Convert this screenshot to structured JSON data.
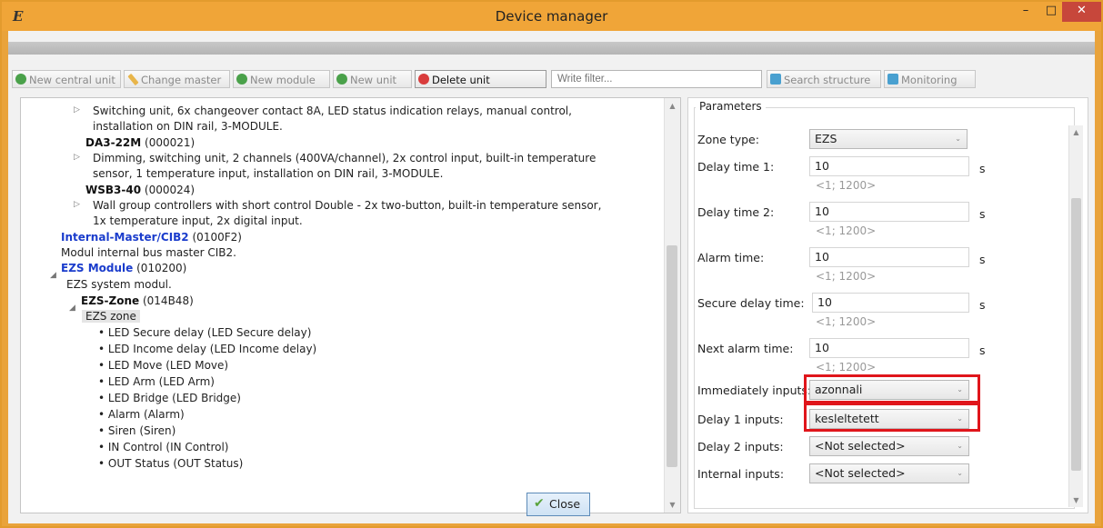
{
  "window": {
    "title": "Device manager",
    "app_icon": "E",
    "minimize": "–",
    "maximize": "□",
    "close": "✕"
  },
  "toolbar": {
    "new_central_unit": "New central unit",
    "change_master": "Change master",
    "new_module": "New module",
    "new_unit": "New unit",
    "delete_unit": "Delete unit",
    "filter_placeholder": "Write filter...",
    "search_structure": "Search structure",
    "monitoring": "Monitoring"
  },
  "tree": {
    "switching_desc_1": "Switching unit, 6x changeover contact 8A, LED status indication relays, manual control,",
    "switching_desc_2": "installation on DIN rail, 3-MODULE.",
    "da3_name": "DA3-22M",
    "da3_id": "(000021)",
    "da3_desc_1": "Dimming, switching unit, 2 channels (400VA/channel), 2x control input, built-in temperature",
    "da3_desc_2": "sensor, 1 temperature input, installation on DIN rail, 3-MODULE.",
    "wsb_name": "WSB3-40",
    "wsb_id": "(000024)",
    "wsb_desc_1": "Wall group controllers with short control Double - 2x two-button, built-in temperature sensor,",
    "wsb_desc_2": "1x temperature input, 2x digital input.",
    "internal_master_name": "Internal-Master/CIB2",
    "internal_master_id": "(0100F2)",
    "internal_master_desc": "Modul internal bus master CIB2.",
    "ezs_module_name": "EZS Module",
    "ezs_module_id": "(010200)",
    "ezs_module_desc": "EZS system modul.",
    "ezs_zone_name": "EZS-Zone",
    "ezs_zone_id": "(014B48)",
    "ezs_zone_desc": "EZS zone",
    "children": [
      "• LED Secure delay (LED Secure delay)",
      "• LED Income delay (LED Income delay)",
      "• LED Move (LED Move)",
      "• LED Arm (LED Arm)",
      "• LED Bridge (LED Bridge)",
      "• Alarm (Alarm)",
      "• Siren (Siren)",
      "• IN Control (IN Control)",
      "• OUT Status (OUT Status)"
    ]
  },
  "params": {
    "legend": "Parameters",
    "zone_type_label": "Zone type:",
    "zone_type_value": "EZS",
    "delay1_label": "Delay time 1:",
    "delay1_value": "10",
    "delay2_label": "Delay time 2:",
    "delay2_value": "10",
    "alarm_label": "Alarm time:",
    "alarm_value": "10",
    "secure_label": "Secure delay time:",
    "secure_value": "10",
    "next_alarm_label": "Next alarm time:",
    "next_alarm_value": "10",
    "unit": "s",
    "range": "<1; 1200>",
    "immediately_label": "Immediately inputs:",
    "immediately_value": "azonnali",
    "delay1_inputs_label": "Delay 1 inputs:",
    "delay1_inputs_value": "kesleltetett",
    "delay2_inputs_label": "Delay 2 inputs:",
    "delay2_inputs_value": "<Not selected>",
    "internal_inputs_label": "Internal inputs:",
    "internal_inputs_value": "<Not selected>"
  },
  "footer": {
    "close_label": "Close"
  },
  "colors": {
    "title_bar": "#f0a538",
    "close_button": "#c7473b",
    "link_blue": "#1a3ccc",
    "highlight_red": "#e0151b"
  }
}
